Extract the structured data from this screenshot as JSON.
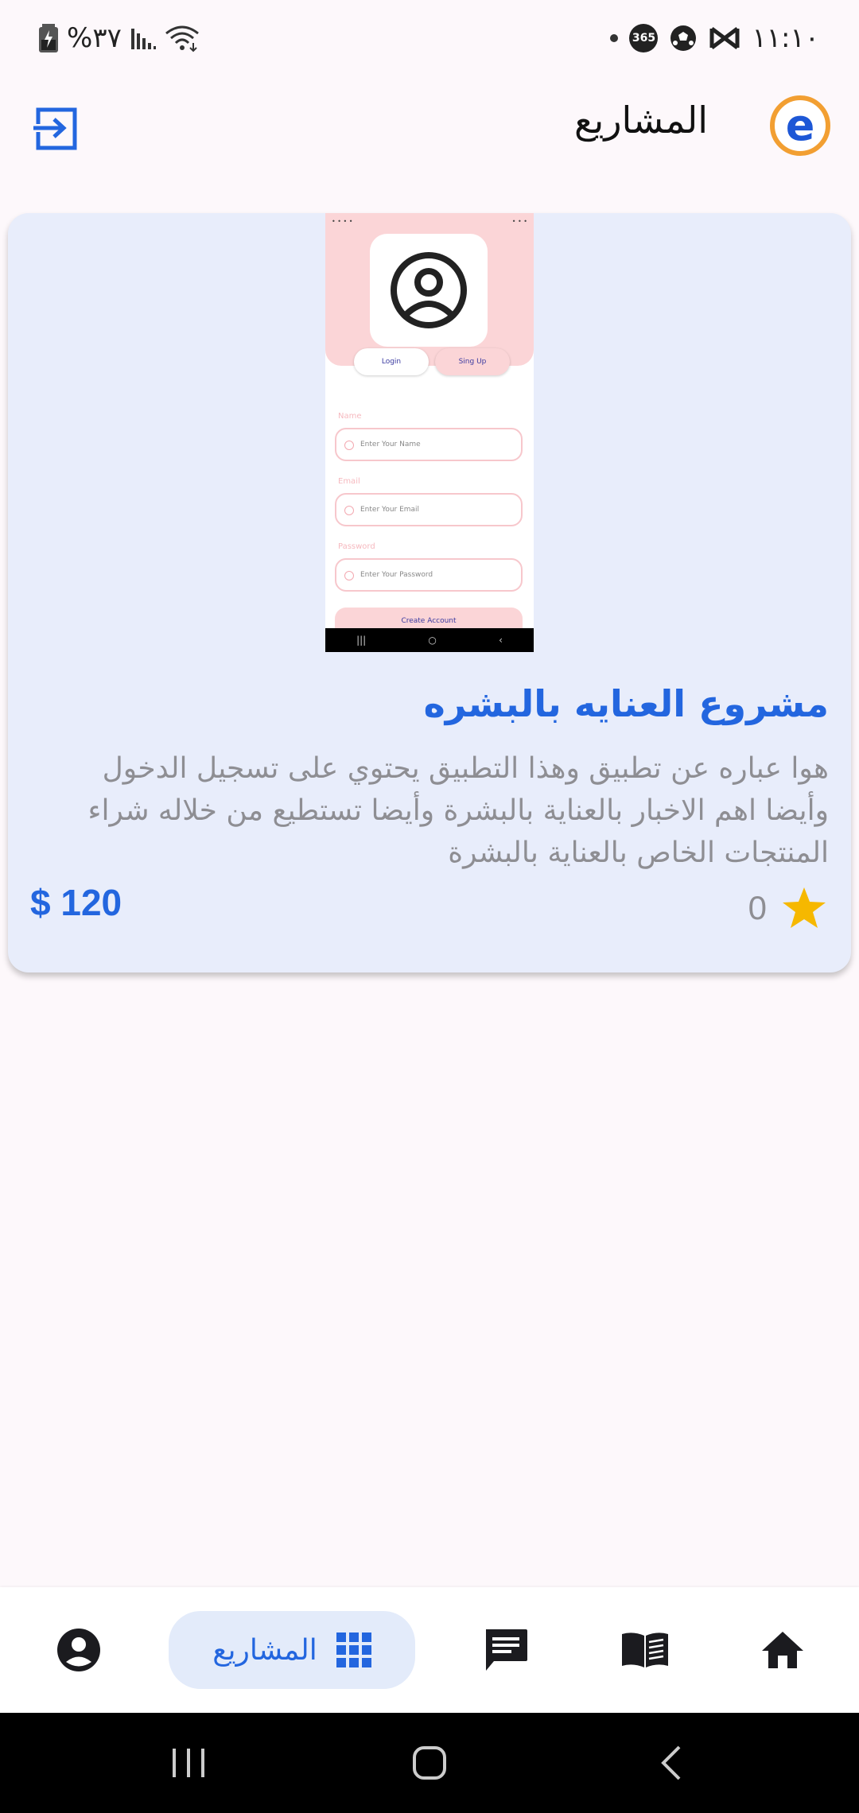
{
  "status_bar": {
    "time": "١١:١٠",
    "battery": "%٣٧",
    "badge_365": "365"
  },
  "app_bar": {
    "title": "المشاريع",
    "logo_letter": "e"
  },
  "project_card": {
    "title": "مشروع العنايه بالبشره",
    "description": "هوا عباره عن تطبيق وهذا التطبيق يحتوي على تسجيل الدخول وأيضا اهم الاخبار بالعناية بالبشرة وأيضا  تستطيع من خلاله شراء المنتجات الخاص بالعناية بالبشرة",
    "rating": "0",
    "price": "$ 120",
    "thumbnail": {
      "tab_login": "Login",
      "tab_signup": "Sing Up",
      "label_name": "Name",
      "placeholder_name": "Enter Your Name",
      "label_email": "Email",
      "placeholder_email": "Enter Your Email",
      "label_password": "Password",
      "placeholder_password": "Enter Your Password",
      "create_account": "Create Account"
    }
  },
  "bottom_nav": {
    "items": [
      {
        "icon": "home-icon"
      },
      {
        "icon": "book-icon"
      },
      {
        "icon": "chat-icon"
      },
      {
        "icon": "grid-icon",
        "label": "المشاريع",
        "active": true
      },
      {
        "icon": "account-icon"
      }
    ]
  },
  "colors": {
    "accent": "#2366df",
    "card_bg": "#e8edfb",
    "star": "#f6b800",
    "logo_ring": "#f29f32"
  }
}
